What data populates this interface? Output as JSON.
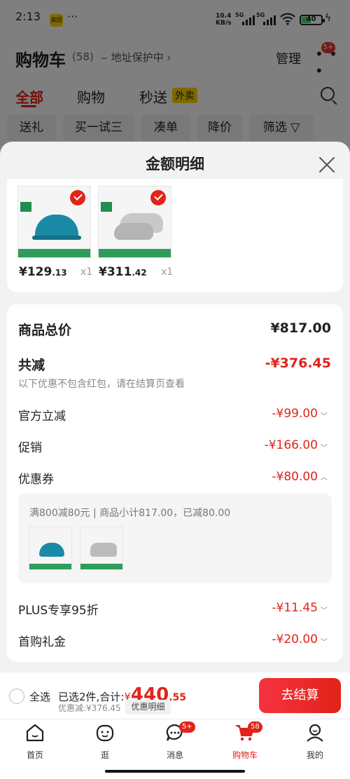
{
  "status": {
    "time": "2:13",
    "app_badge": "美团",
    "net_speed": "10.4",
    "net_unit": "KB/s",
    "sig1": "5G",
    "sig2": "5G",
    "battery": "40"
  },
  "header": {
    "title": "购物车",
    "count": "(58)",
    "address": "地址保护中",
    "manage": "管理",
    "more_badge": "5+"
  },
  "tabs": [
    "全部",
    "购物",
    "秒送"
  ],
  "waimai_tag": "外卖",
  "chips": [
    "送礼",
    "买一试三",
    "凑单",
    "降价",
    "筛选"
  ],
  "sheet": {
    "title": "金额明细",
    "products": [
      {
        "price_int": "¥129",
        "price_dec": ".13",
        "qty": "x1"
      },
      {
        "price_int": "¥311",
        "price_dec": ".42",
        "qty": "x1"
      }
    ],
    "total": {
      "label": "商品总价",
      "value": "¥817.00"
    },
    "discount": {
      "label": "共减",
      "value": "-¥376.45",
      "note": "以下优惠不包含红包，请在结算页查看"
    },
    "rows": [
      {
        "label": "官方立减",
        "value": "-¥99.00"
      },
      {
        "label": "促销",
        "value": "-¥166.00"
      },
      {
        "label": "优惠券",
        "value": "-¥80.00"
      }
    ],
    "coupon_detail": "满800减80元 | 商品小计817.00，已减80.00",
    "rows2": [
      {
        "label": "PLUS专享95折",
        "value": "-¥11.45"
      },
      {
        "label": "首购礼金",
        "value": "-¥20.00"
      }
    ]
  },
  "bottom": {
    "select_all": "全选",
    "selected": "已选2件,合计:",
    "amount_sym": "¥",
    "amount_int": "440",
    "amount_dec": ".55",
    "saved": "优惠减:¥376.45",
    "detail_btn": "优惠明细",
    "pay": "去结算"
  },
  "nav": [
    {
      "label": "首页",
      "icon": "home-icon"
    },
    {
      "label": "逛",
      "icon": "face-icon"
    },
    {
      "label": "消息",
      "icon": "message-icon",
      "badge": "5+"
    },
    {
      "label": "购物车",
      "icon": "cart-icon",
      "badge": "58"
    },
    {
      "label": "我的",
      "icon": "profile-icon"
    }
  ],
  "colors": {
    "accent": "#e2231a",
    "chip_bg": "#f3f3f3",
    "sheet_bg": "#f2f2f2"
  }
}
